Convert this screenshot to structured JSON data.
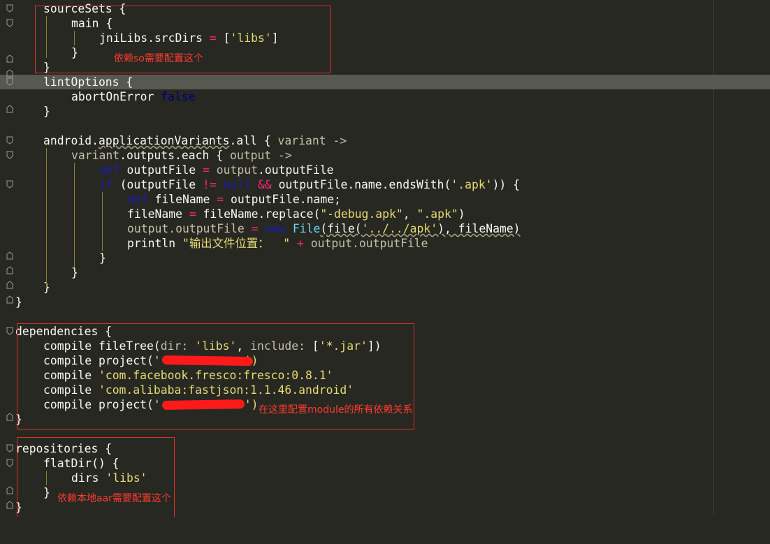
{
  "lines": {
    "l0": "sourceSets {",
    "l1": "main {",
    "l2a": "jniLibs.srcDirs ",
    "l2b": "=",
    "l2c": " [",
    "l2d": "'libs'",
    "l2e": "]",
    "l3": "}",
    "l4": "}",
    "l5": "lintOptions {",
    "l6a": "abortOnError ",
    "l6b": "false",
    "l7": "}",
    "l9a": "android.",
    "l9b": "applicationVariants",
    "l9c": ".all { ",
    "l9d": "variant ->",
    "l10a": "variant",
    "l10b": ".outputs.each { ",
    "l10c": "output ->",
    "l11a": "def",
    "l11b": " outputFile ",
    "l11c": "=",
    "l11d": " output",
    "l11e": ".outputFile",
    "l12a": "if",
    "l12b": " (outputFile ",
    "l12c": "!=",
    "l12d": " null",
    "l12e": " ",
    "l12f": "&&",
    "l12g": " outputFile.name.endsWith(",
    "l12h": "'.apk'",
    "l12i": ")) {",
    "l13a": "def",
    "l13b": " fileName ",
    "l13c": "=",
    "l13d": " outputFile.name;",
    "l14a": "fileName ",
    "l14b": "=",
    "l14c": " fileName.replace(",
    "l14d": "\"-debug.apk\"",
    "l14e": ", ",
    "l14f": "\".apk\"",
    "l14g": ")",
    "l15a": "output",
    "l15b": ".outputFile ",
    "l15c": "=",
    "l15d": " new",
    "l15e": " File",
    "l15f": "(file(",
    "l15g": "'../../apk'",
    "l15h": "), fileName)",
    "l16a": "println ",
    "l16b": "\"输出文件位置：  \"",
    "l16c": " +",
    "l16d": " output",
    "l16e": ".outputFile",
    "l17": "}",
    "l18": "}",
    "l19": "}",
    "l20": "}",
    "l22": "dependencies {",
    "l23a": "compile fileTree(",
    "l23b": "dir: ",
    "l23c": "'libs'",
    "l23d": ", ",
    "l23e": "include: ",
    "l23f": "[",
    "l23g": "'*.jar'",
    "l23h": "])",
    "l24a": "compile project(",
    "l24b": "'",
    "l24c": "')",
    "l25a": "compile ",
    "l25b": "'com.facebook.fresco:fresco:0.8.1'",
    "l26a": "compile ",
    "l26b": "'com.alibaba:fastjson:1.1.46.android'",
    "l27a": "compile project(",
    "l27b": "'",
    "l27c": "')",
    "l28": "}",
    "l30": "repositories {",
    "l31": "flatDir() {",
    "l32a": "dirs ",
    "l32b": "'libs'",
    "l33": "}",
    "l34": "}"
  },
  "annotations": {
    "so_note": "依赖so需要配置这个",
    "module_note": "在这里配置module的所有依赖关系",
    "aar_note": "依赖本地aar需要配置这个"
  },
  "colors": {
    "background": "#272822",
    "highlight_line": "#575850",
    "annotation_red": "#ff3a2e"
  }
}
